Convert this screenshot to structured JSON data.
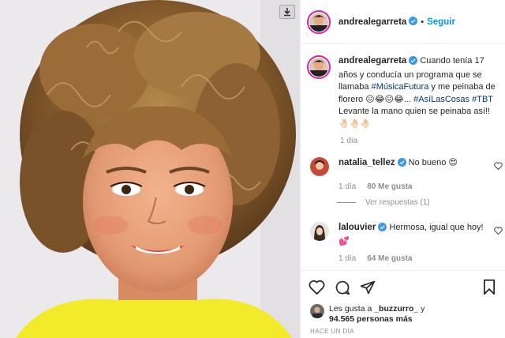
{
  "post": {
    "username": "andrealegarreta",
    "follow_label": "Seguir",
    "separator": "•"
  },
  "caption": {
    "username": "andrealegarreta",
    "text_1": "Cuando tenía 17 años y conducía un programa que se llamaba ",
    "tag_1": "#MúsicaFutura",
    "text_2": " y me peinaba de florero 😖😂😖😂... ",
    "tag_2": "#AsíLasCosas",
    "text_3": " ",
    "tag_3": "#TBT",
    "text_4": " Levante la mano quien se peinaba así!! 🤚🏻🤚🏻🤚🏻",
    "time": "1 día"
  },
  "comments": [
    {
      "username": "natalia_tellez",
      "text": "No bueno 😍",
      "time": "1 día",
      "likes": "80 Me gusta",
      "replies_label": "Ver respuestas (1)"
    },
    {
      "username": "lalouvier",
      "text": "Hermosa, igual que hoy! 💕",
      "time": "1 día",
      "likes": "64 Me gusta"
    }
  ],
  "likes": {
    "prefix": "Les gusta a ",
    "user": "_buzzurro_",
    "mid": " y",
    "count": "94.565 personas más"
  },
  "time_ago": "HACE UN DÍA",
  "icons": {
    "like": "heart-icon",
    "comment": "comment-icon",
    "share": "share-icon",
    "save": "bookmark-icon"
  },
  "colors": {
    "accent": "#0095f6",
    "verified": "#3897f0",
    "hashtag": "#00376b",
    "muted": "#8e8e8e"
  }
}
